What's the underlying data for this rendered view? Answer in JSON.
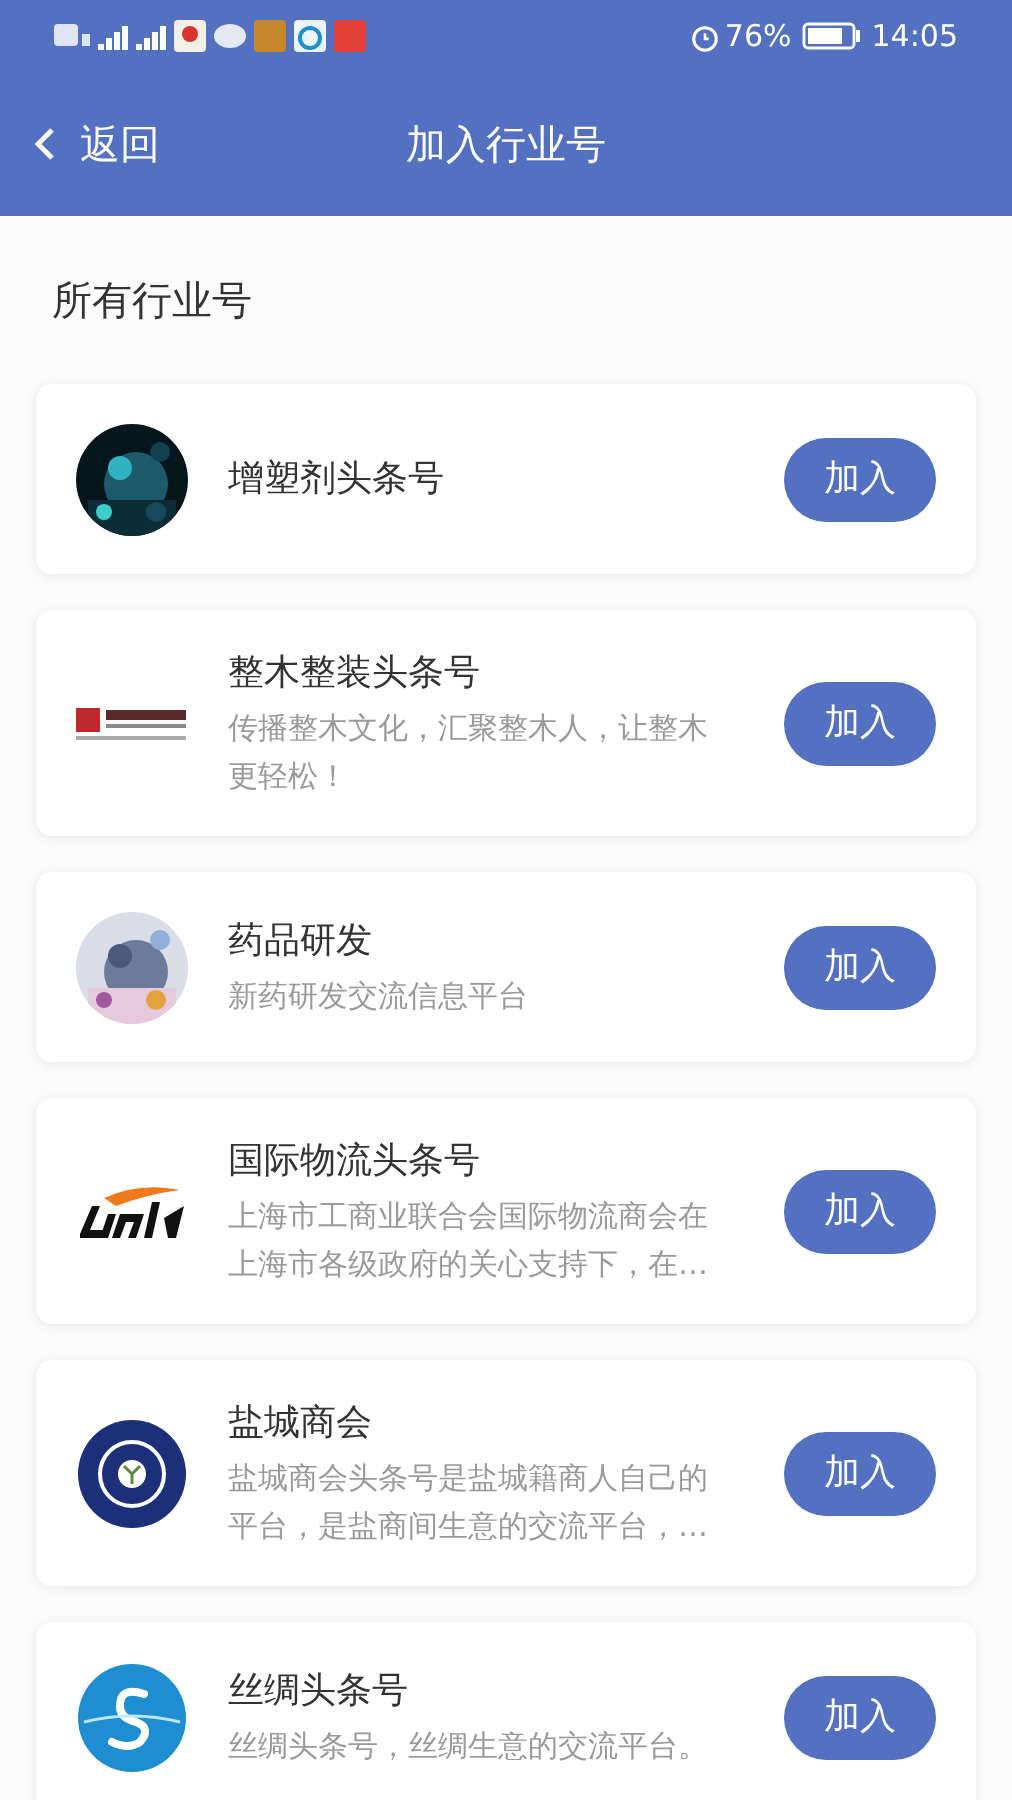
{
  "status_bar": {
    "battery": "76%",
    "time": "14:05"
  },
  "header": {
    "back": "返回",
    "title": "加入行业号"
  },
  "section_title": "所有行业号",
  "accounts": [
    {
      "name": "增塑剂头条号",
      "kind": "picture",
      "button": "加入"
    },
    {
      "name": "整木整装头条号",
      "description": "传播整木文化，汇聚整木人，让整木更轻松！",
      "kind": "seal",
      "button": "加入"
    },
    {
      "name": "药品研发",
      "description": "新药研发交流信息平台",
      "kind": "picture",
      "button": "加入"
    },
    {
      "name": "国际物流头条号",
      "description": "上海市工商业联合会国际物流商会在上海市各级政府的关心支持下，在…",
      "kind": "swoosh",
      "button": "加入"
    },
    {
      "name": "盐城商会",
      "description": "盐城商会头条号是盐城籍商人自己的平台，是盐商间生意的交流平台，…",
      "kind": "emblem",
      "button": "加入"
    },
    {
      "name": "丝绸头条号",
      "description": "丝绸头条号，丝绸生意的交流平台。",
      "kind": "swirl",
      "button": "加入"
    }
  ]
}
